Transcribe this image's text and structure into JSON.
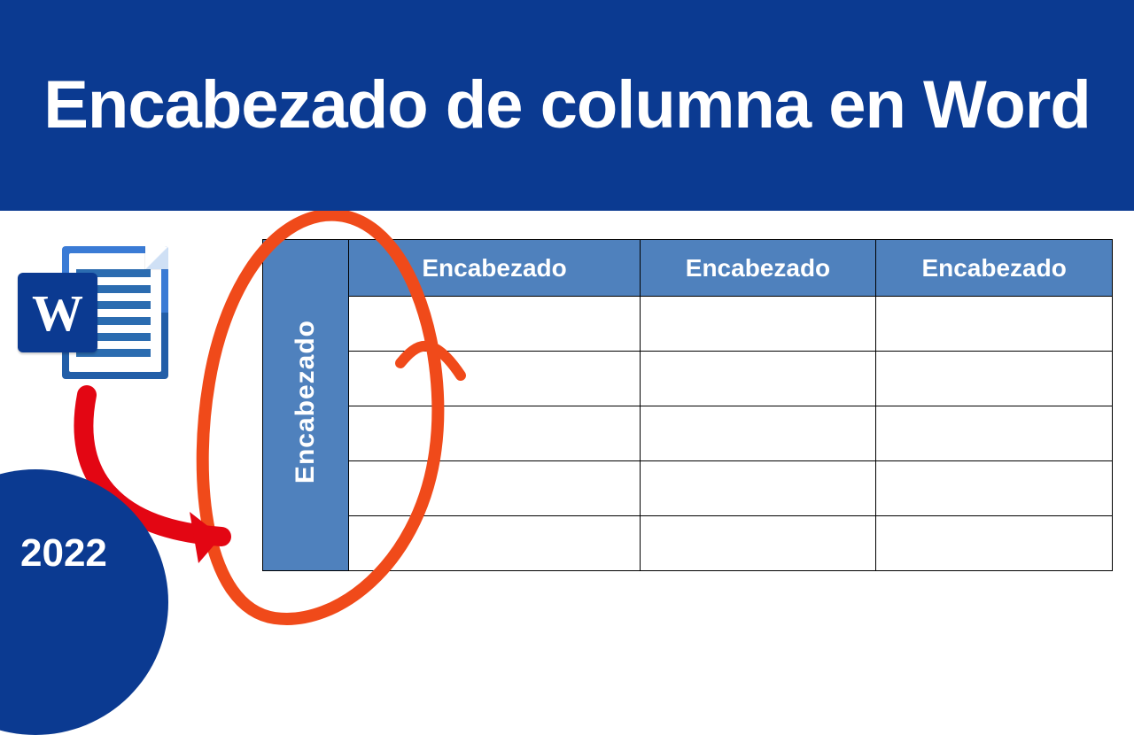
{
  "title": "Encabezado de columna en Word",
  "word_icon_letter": "W",
  "year": "2022",
  "table": {
    "row_header": "Encabezado",
    "col_headers": [
      "Encabezado",
      "Encabezado",
      "Encabezado"
    ],
    "body_rows": 5
  },
  "colors": {
    "brand_blue": "#0b3a91",
    "table_header_blue": "#4f81bd",
    "highlight_orange": "#f04a1a",
    "arrow_red": "#e30613"
  }
}
